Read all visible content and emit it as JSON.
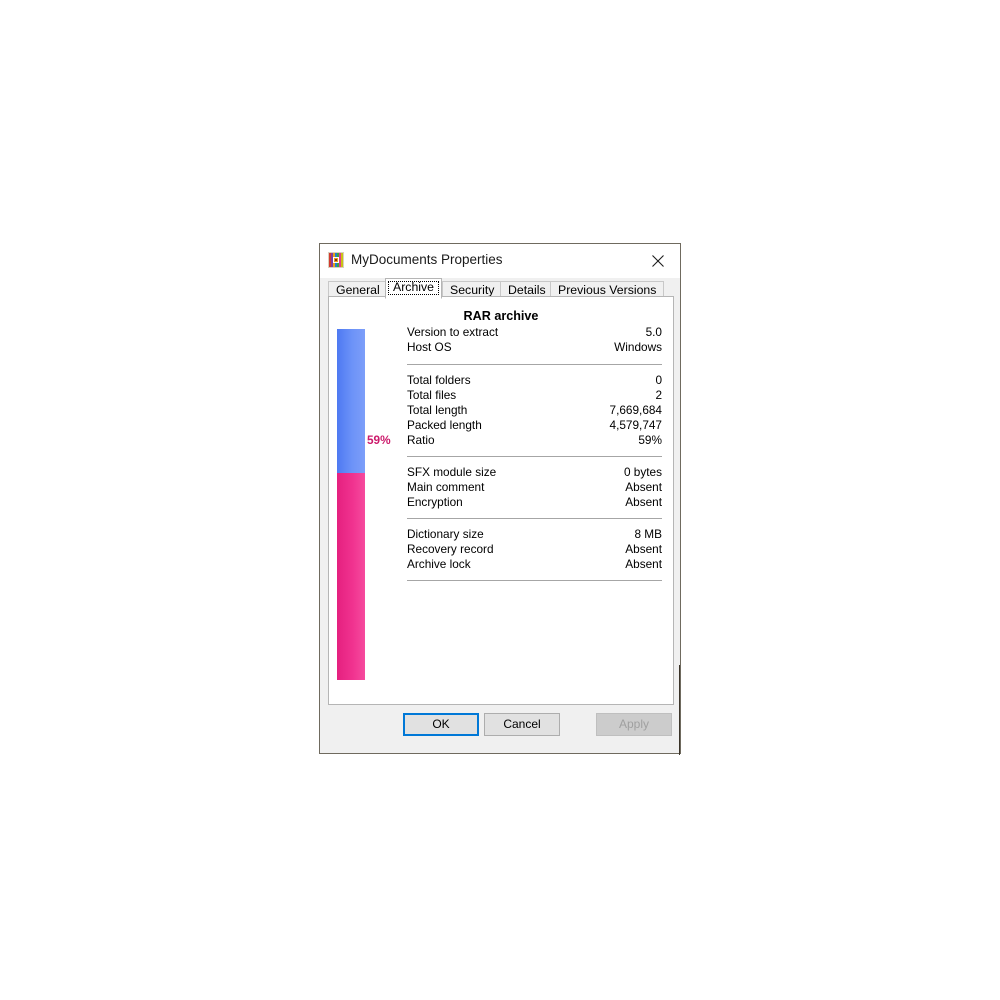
{
  "window": {
    "title": "MyDocuments Properties",
    "icon": "winrar-books-icon",
    "close_label": "✕"
  },
  "tabs": [
    {
      "label": "General",
      "selected": false
    },
    {
      "label": "Archive",
      "selected": true
    },
    {
      "label": "Security",
      "selected": false
    },
    {
      "label": "Details",
      "selected": false
    },
    {
      "label": "Previous Versions",
      "selected": false
    }
  ],
  "panel": {
    "heading": "RAR archive",
    "ratio_label": "59%",
    "groups": [
      {
        "rows": [
          {
            "key": "Version to extract",
            "value": "5.0"
          },
          {
            "key": "Host OS",
            "value": "Windows"
          }
        ]
      },
      {
        "rows": [
          {
            "key": "Total folders",
            "value": "0"
          },
          {
            "key": "Total files",
            "value": "2"
          },
          {
            "key": "Total length",
            "value": "7,669,684"
          },
          {
            "key": "Packed length",
            "value": "4,579,747"
          },
          {
            "key": "Ratio",
            "value": "59%"
          }
        ]
      },
      {
        "rows": [
          {
            "key": "SFX module size",
            "value": "0 bytes"
          },
          {
            "key": "Main comment",
            "value": "Absent"
          },
          {
            "key": "Encryption",
            "value": "Absent"
          }
        ]
      },
      {
        "rows": [
          {
            "key": "Dictionary size",
            "value": "8 MB"
          },
          {
            "key": "Recovery record",
            "value": "Absent"
          },
          {
            "key": "Archive lock",
            "value": "Absent"
          }
        ]
      }
    ]
  },
  "buttons": {
    "ok": "OK",
    "cancel": "Cancel",
    "apply": "Apply"
  },
  "colors": {
    "unpacked_bar": "#6d93f8",
    "packed_bar": "#f0328f",
    "ratio_text": "#cc1a6b",
    "focus_border": "#0078d7",
    "disabled_text": "#a0a0a0"
  }
}
